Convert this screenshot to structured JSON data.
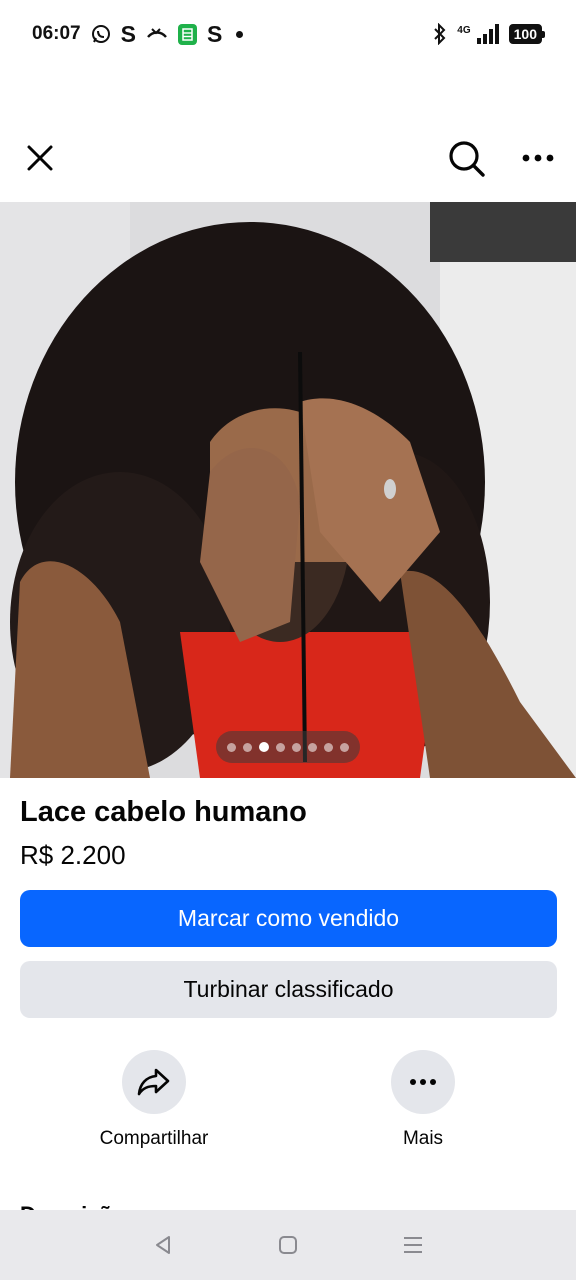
{
  "status_bar": {
    "time": "06:07",
    "left_icons": [
      "whatsapp-icon",
      "s-app-icon",
      "missed-call-icon",
      "sheets-icon",
      "s-app-icon",
      "notification-dot"
    ],
    "s_glyph": "S",
    "network": "4G",
    "battery": "100"
  },
  "app_bar": {
    "icons": [
      "close-icon",
      "search-icon",
      "more-icon"
    ]
  },
  "photo": {
    "pager_count": 8,
    "pager_active_index": 2
  },
  "listing": {
    "title": "Lace cabelo humano",
    "price": "R$ 2.200"
  },
  "buttons": {
    "mark_sold": "Marcar como vendido",
    "boost": "Turbinar classificado"
  },
  "actions": {
    "share_label": "Compartilhar",
    "more_label": "Mais"
  },
  "description_peek": "Descrição",
  "colors": {
    "primary": "#0866ff",
    "secondary_bg": "#e4e6eb",
    "text": "#050505"
  }
}
